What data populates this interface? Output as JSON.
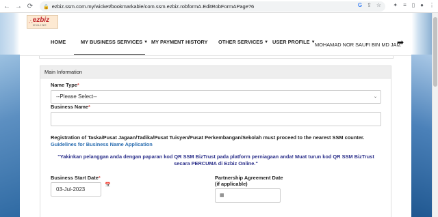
{
  "browser": {
    "url": "ezbiz.ssm.com.my/wicket/bookmarkable/com.ssm.ezbiz.robformA.EditRobFormAPage?6"
  },
  "logo": {
    "brand": "ezbiz",
    "sub": "ONLINE",
    "color": "#c1272d"
  },
  "menu": {
    "items": [
      {
        "label": "HOME",
        "has_dropdown": false
      },
      {
        "label": "MY BUSINESS SERVICES",
        "has_dropdown": true
      },
      {
        "label": "MY PAYMENT HISTORY",
        "has_dropdown": false
      },
      {
        "label": "OTHER SERVICES",
        "has_dropdown": true
      },
      {
        "label": "USER PROFILE",
        "has_dropdown": true
      }
    ],
    "active": "MY BUSINESS SERVICES",
    "user_name": "MOHAMAD NOR SAUFI BIN MD JAIZ",
    "logout_icon": "sign-out-icon"
  },
  "panel": {
    "heading": "Main Information",
    "name_type": {
      "label": "Name Type",
      "required_mark": "*",
      "selected": "--Please Select--"
    },
    "business_name": {
      "label": "Business Name",
      "required_mark": "*",
      "value": ""
    },
    "notice": "Registration of Taska/Pusat Jagaan/Tadika/Pusat Tuisyen/Pusat Perkembangan/Sekolah must proceed to the nearest SSM counter.",
    "guide_link": "Guidelines for Business Name Application",
    "promo_line1": "\"Yakinkan pelanggan anda dengan paparan kod QR SSM BizTrust pada platform perniagaan anda! Muat turun kod QR SSM BizTrust",
    "promo_line2": "secara  PERCUMA di Ezbiz Online.\"",
    "start_date": {
      "label": "Business Start Date",
      "required_mark": "*",
      "value": "03-Jul-2023"
    },
    "partnership": {
      "label_line1": "Partnership Agreement Date",
      "label_line2": "(if applicable)",
      "value": ""
    }
  },
  "colors": {
    "link": "#2a6db0",
    "promo": "#2b2f8a",
    "required": "#d9534f"
  }
}
